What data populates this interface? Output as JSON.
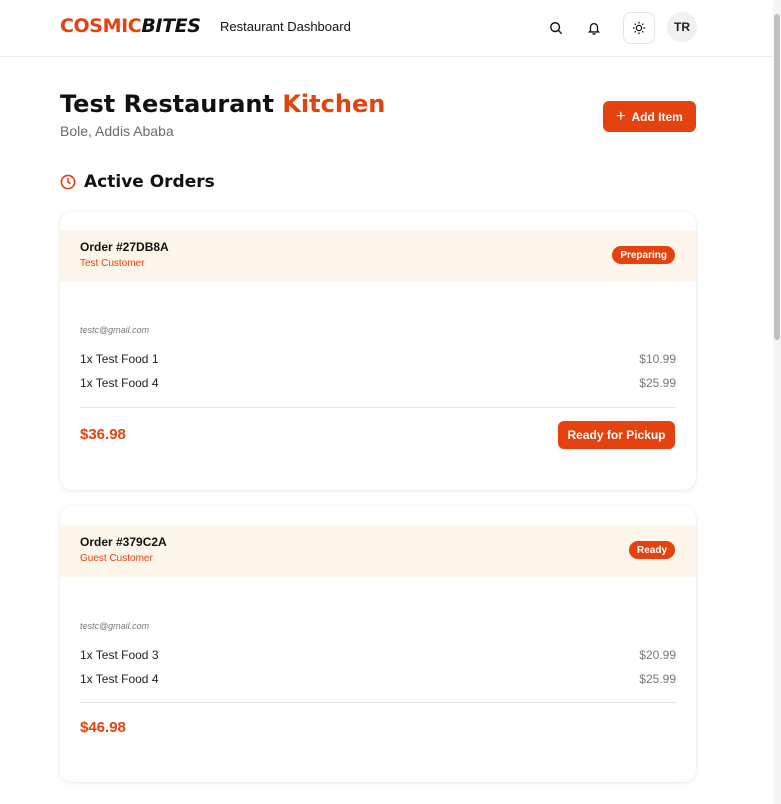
{
  "header": {
    "logo_part1": "COSMIC",
    "logo_part2": "BITES",
    "nav_title": "Restaurant Dashboard",
    "icons": [
      "search-icon",
      "bell-icon",
      "sun-icon"
    ],
    "avatar_initials": "TR"
  },
  "restaurant": {
    "name": "Test Restaurant",
    "name_accent": "Kitchen",
    "location": "Bole, Addis Ababa",
    "add_item_label": "Add Item"
  },
  "section": {
    "title": "Active Orders",
    "icon": "clock-icon"
  },
  "orders": [
    {
      "id": "Order #27DB8A",
      "customer": "Test Customer",
      "status": "Preparing",
      "email": "testc@gmail.com",
      "items": [
        {
          "name": "1x Test Food 1",
          "price": "$10.99"
        },
        {
          "name": "1x Test Food 4",
          "price": "$25.99"
        }
      ],
      "total": "$36.98",
      "action": "Ready for Pickup"
    },
    {
      "id": "Order #379C2A",
      "customer": "Guest Customer",
      "status": "Ready",
      "email": "testc@gmail.com",
      "items": [
        {
          "name": "1x Test Food 3",
          "price": "$20.99"
        },
        {
          "name": "1x Test Food 4",
          "price": "$25.99"
        }
      ],
      "total": "$46.98"
    }
  ],
  "colors": {
    "accent": "#e4420f",
    "order_header_bg": "#fef6ea"
  }
}
